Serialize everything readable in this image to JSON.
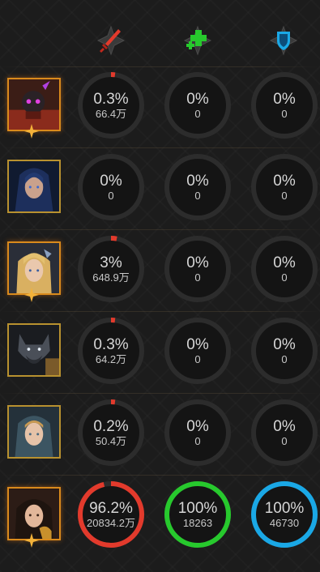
{
  "columns": [
    {
      "icon": "sword-icon",
      "color": "#e23a2c"
    },
    {
      "icon": "heal-cross-icon",
      "color": "#27c92d"
    },
    {
      "icon": "shield-icon",
      "color": "#1aa8e6"
    }
  ],
  "heroes": [
    {
      "name": "hero-1",
      "portrait": "dark-brute-portrait",
      "frame": "orange",
      "badge": true,
      "damage": {
        "pct": "0.3%",
        "value": "66.4万",
        "fill": 0.003
      },
      "heal": {
        "pct": "0%",
        "value": "0",
        "fill": 0
      },
      "tank": {
        "pct": "0%",
        "value": "0",
        "fill": 0
      }
    },
    {
      "name": "hero-2",
      "portrait": "hooded-woman-portrait",
      "frame": "gold",
      "badge": false,
      "damage": {
        "pct": "0%",
        "value": "0",
        "fill": 0
      },
      "heal": {
        "pct": "0%",
        "value": "0",
        "fill": 0
      },
      "tank": {
        "pct": "0%",
        "value": "0",
        "fill": 0
      }
    },
    {
      "name": "hero-3",
      "portrait": "blonde-mage-portrait",
      "frame": "orange",
      "badge": true,
      "damage": {
        "pct": "3%",
        "value": "648.9万",
        "fill": 0.03
      },
      "heal": {
        "pct": "0%",
        "value": "0",
        "fill": 0
      },
      "tank": {
        "pct": "0%",
        "value": "0",
        "fill": 0
      }
    },
    {
      "name": "hero-4",
      "portrait": "werewolf-portrait",
      "frame": "gold",
      "badge": false,
      "damage": {
        "pct": "0.3%",
        "value": "64.2万",
        "fill": 0.003
      },
      "heal": {
        "pct": "0%",
        "value": "0",
        "fill": 0
      },
      "tank": {
        "pct": "0%",
        "value": "0",
        "fill": 0
      }
    },
    {
      "name": "hero-5",
      "portrait": "hooded-girl-portrait",
      "frame": "gold",
      "badge": false,
      "damage": {
        "pct": "0.2%",
        "value": "50.4万",
        "fill": 0.002
      },
      "heal": {
        "pct": "0%",
        "value": "0",
        "fill": 0
      },
      "tank": {
        "pct": "0%",
        "value": "0",
        "fill": 0
      }
    },
    {
      "name": "hero-6",
      "portrait": "dark-haired-woman-portrait",
      "frame": "orange",
      "badge": true,
      "damage": {
        "pct": "96.2%",
        "value": "20834.2万",
        "fill": 0.962
      },
      "heal": {
        "pct": "100%",
        "value": "18263",
        "fill": 1
      },
      "tank": {
        "pct": "100%",
        "value": "46730",
        "fill": 1
      }
    }
  ]
}
